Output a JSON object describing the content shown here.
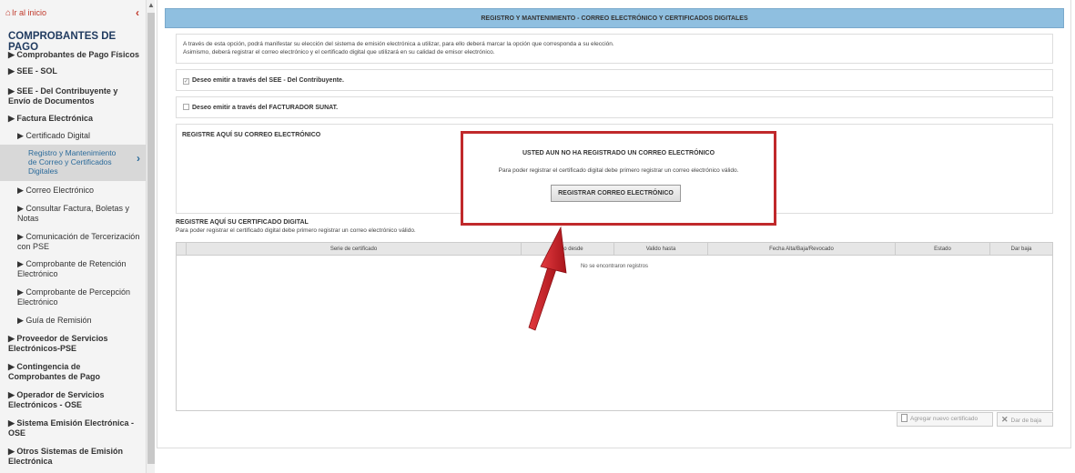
{
  "sidebar": {
    "home_link": "Ir al inicio",
    "title": "COMPROBANTES DE PAGO",
    "items": [
      {
        "label": "▶ Comprobantes de Pago Físicos"
      },
      {
        "label": "▶ SEE - SOL"
      },
      {
        "label": "▶ SEE - Del Contribuyente y Envío de Documentos"
      },
      {
        "label": "▶ Factura Electrónica"
      },
      {
        "label": "▶ Certificado Digital"
      },
      {
        "label": "Registro y Mantenimiento de Correo y Certificados Digitales"
      },
      {
        "label": "▶ Correo Electrónico"
      },
      {
        "label": "▶ Consultar Factura, Boletas y Notas"
      },
      {
        "label": "▶ Comunicación de Tercerización con PSE"
      },
      {
        "label": "▶ Comprobante de Retención Electrónico"
      },
      {
        "label": "▶ Comprobante de Percepción Electrónico"
      },
      {
        "label": "▶ Guía de Remisión"
      },
      {
        "label": "▶ Proveedor de Servicios Electrónicos-PSE"
      },
      {
        "label": "▶ Contingencia de Comprobantes de Pago"
      },
      {
        "label": "▶ Operador de Servicios Electrónicos - OSE"
      },
      {
        "label": "▶ Sistema Emisión Electrónica - OSE"
      },
      {
        "label": "▶ Otros Sistemas de Emisión Electrónica"
      }
    ]
  },
  "main": {
    "title": "REGISTRO Y MANTENIMIENTO - CORREO ELECTRÓNICO Y CERTIFICADOS DIGITALES",
    "intro_line1": "A través de esta opción, podrá manifestar su elección del sistema de emisión electrónica a utilizar, para ello deberá marcar la opción que corresponda a su elección.",
    "intro_line2": "Asimismo, deberá registrar el correo electrónico y el certificado digital que utilizará en su calidad de emisor electrónico.",
    "option_see": {
      "label": "Deseo emitir a través del SEE - Del Contribuyente.",
      "checked": true
    },
    "option_facturador": {
      "label": "Deseo emitir a través del FACTURADOR SUNAT.",
      "checked": false
    },
    "email_section_title": "REGISTRE AQUÍ SU CORREO ELECTRÓNICO",
    "email_notice": {
      "title": "USTED AUN NO HA REGISTRADO UN CORREO ELECTRÓNICO",
      "text": "Para poder registrar el certificado digital debe primero registrar un correo electrónico válido.",
      "button": "REGISTRAR CORREO ELECTRÓNICO"
    },
    "cert_section_title": "REGISTRE AQUÍ SU CERTIFICADO DIGITAL",
    "cert_section_sub": "Para poder registrar el certificado digital debe primero registrar un correo electrónico válido.",
    "grid": {
      "columns": [
        "Serie de certificado",
        "Valido desde",
        "Valido hasta",
        "Fecha Alta/Baja/Revocado",
        "Estado",
        "Dar baja"
      ],
      "empty_text": "No se encontraron registros"
    },
    "add_button": "Agregar nuevo certificado",
    "remove_button": "Dar de baja"
  },
  "colors": {
    "highlight": "#c0292b",
    "arrow": "#d4222a",
    "title_bar": "#8fbfe0",
    "sidebar_title": "#1f3a5f"
  }
}
